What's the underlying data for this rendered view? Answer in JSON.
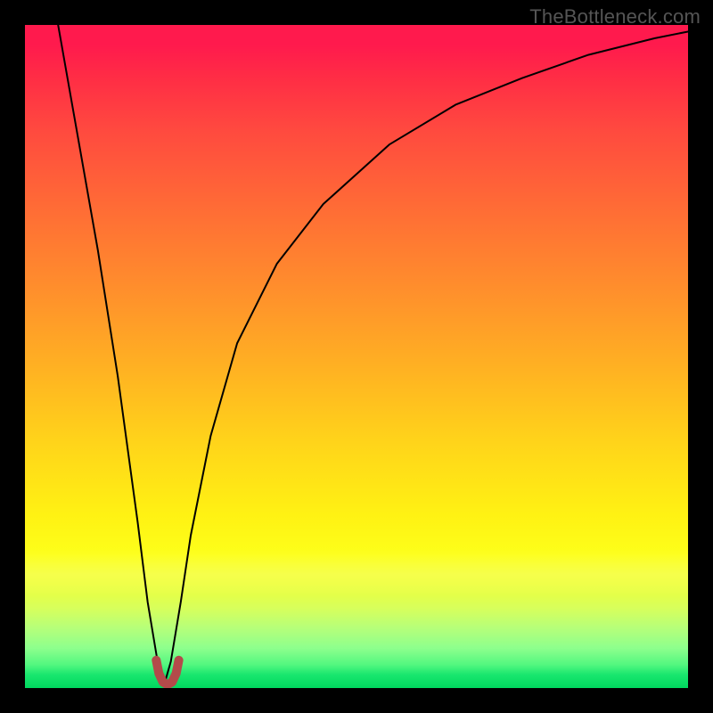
{
  "watermark": "TheBottleneck.com",
  "chart_data": {
    "type": "line",
    "title": "",
    "xlabel": "",
    "ylabel": "",
    "xlim": [
      0,
      100
    ],
    "ylim": [
      0,
      100
    ],
    "grid": false,
    "legend": false,
    "notch_x": 21,
    "series": [
      {
        "name": "bottleneck-curve",
        "x": [
          5,
          8,
          11,
          14,
          17,
          18.5,
          20,
          21,
          22,
          23.5,
          25,
          28,
          32,
          38,
          45,
          55,
          65,
          75,
          85,
          95,
          100
        ],
        "y": [
          100,
          83,
          66,
          47,
          25,
          13,
          4,
          0.5,
          4,
          13,
          23,
          38,
          52,
          64,
          73,
          82,
          88,
          92,
          95.5,
          98,
          99
        ],
        "color": "#000000",
        "width": 2
      },
      {
        "name": "notch-marker",
        "x": [
          19.8,
          20.2,
          20.8,
          21.5,
          22.2,
          22.8,
          23.2
        ],
        "y": [
          4.2,
          2.2,
          0.9,
          0.5,
          0.9,
          2.2,
          4.2
        ],
        "color": "#b34a4a",
        "width": 10
      }
    ]
  }
}
